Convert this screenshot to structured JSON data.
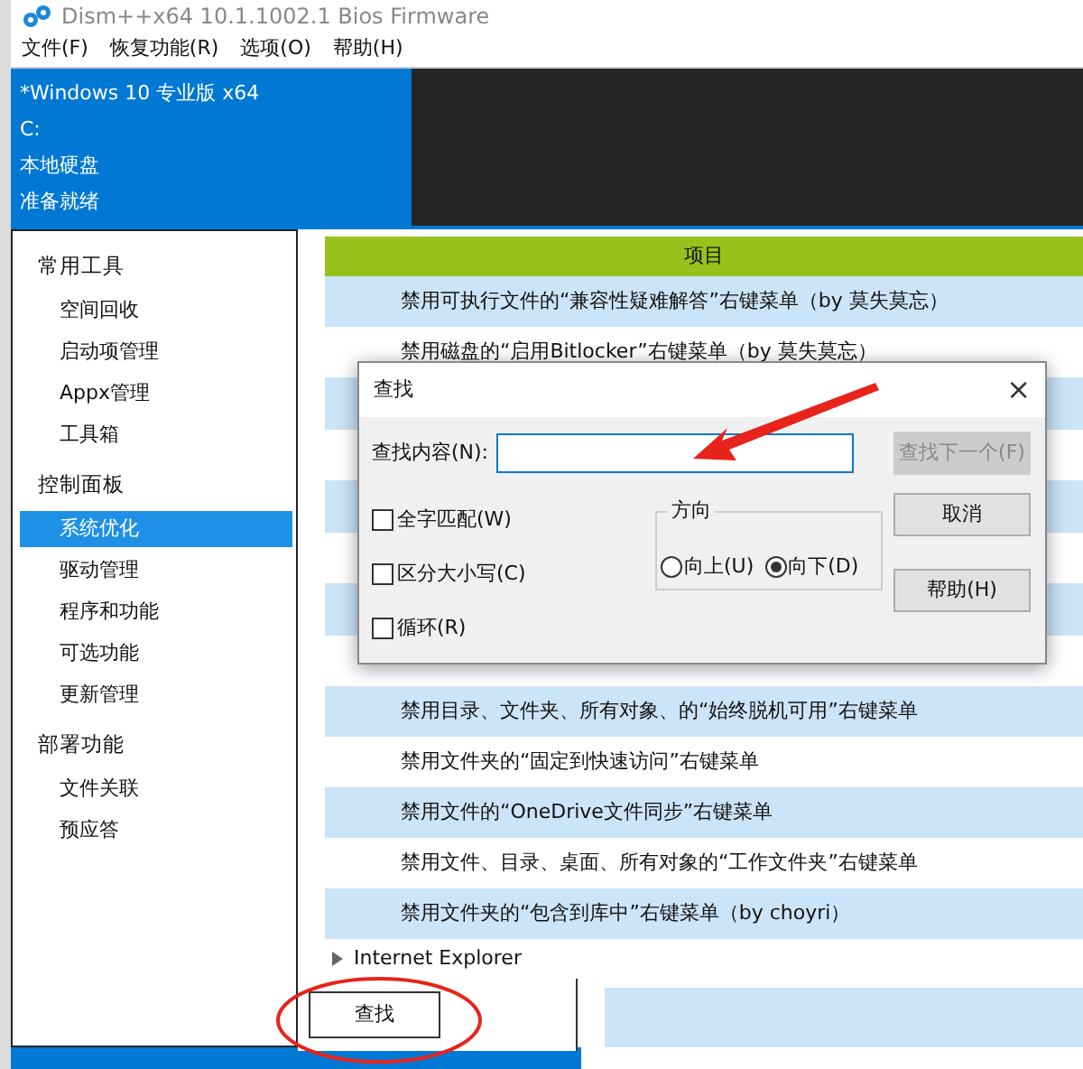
{
  "window": {
    "title": "Dism++x64 10.1.1002.1 Bios Firmware"
  },
  "menu": [
    "文件(F)",
    "恢复功能(R)",
    "选项(O)",
    "帮助(H)"
  ],
  "session": {
    "lines": [
      "*Windows 10 专业版 x64",
      "C:",
      "本地硬盘",
      "准备就绪"
    ]
  },
  "sidebar": [
    {
      "label": "常用工具",
      "items": [
        {
          "label": "空间回收",
          "selected": false
        },
        {
          "label": "启动项管理",
          "selected": false
        },
        {
          "label": "Appx管理",
          "selected": false
        },
        {
          "label": "工具箱",
          "selected": false
        }
      ]
    },
    {
      "label": "控制面板",
      "items": [
        {
          "label": "系统优化",
          "selected": true
        },
        {
          "label": "驱动管理",
          "selected": false
        },
        {
          "label": "程序和功能",
          "selected": false
        },
        {
          "label": "可选功能",
          "selected": false
        },
        {
          "label": "更新管理",
          "selected": false
        }
      ]
    },
    {
      "label": "部署功能",
      "items": [
        {
          "label": "文件关联",
          "selected": false
        },
        {
          "label": "预应答",
          "selected": false
        }
      ]
    }
  ],
  "table": {
    "header": "项目",
    "rows_top": [
      "禁用可执行文件的“兼容性疑难解答”右键菜单（by 莫失莫忘）",
      "禁用磁盘的“启用Bitlocker”右键菜单（by 莫失莫忘）"
    ],
    "rows_bottom": [
      "禁用目录、文件夹、所有对象、的“始终脱机可用”右键菜单",
      "禁用文件夹的“固定到快速访问”右键菜单",
      "禁用文件的“OneDrive文件同步”右键菜单",
      "禁用文件、目录、桌面、所有对象的“工作文件夹”右键菜单",
      "禁用文件夹的“包含到库中”右键菜单（by choyri）"
    ],
    "group": {
      "label": "Internet Explorer",
      "expanded": false
    }
  },
  "find_button": "查找",
  "dialog": {
    "title": "查找",
    "close": "×",
    "find_label": "查找内容(N):",
    "buttons": [
      {
        "label": "查找下一个(F)",
        "disabled": true
      },
      {
        "label": "取消",
        "disabled": false
      },
      {
        "label": "帮助(H)",
        "disabled": false
      }
    ],
    "options": [
      {
        "label": "全字匹配(W)",
        "checked": false
      },
      {
        "label": "区分大小写(C)",
        "checked": false
      },
      {
        "label": "循环(R)",
        "checked": false
      }
    ],
    "direction": {
      "label": "方向",
      "choices": [
        {
          "label": "向上(U)",
          "selected": false
        },
        {
          "label": "向下(D)",
          "selected": true
        }
      ]
    }
  }
}
